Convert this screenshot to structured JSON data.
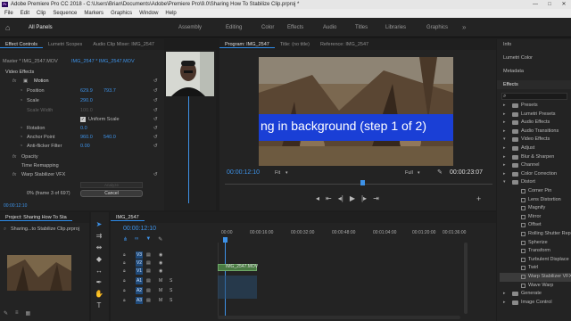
{
  "window": {
    "app_icon": "Pr",
    "title": "Adobe Premiere Pro CC 2018 - C:\\Users\\Brian\\Documents\\Adobe\\Premiere Pro\\9.0\\Sharing How To Stabilize Clip.prproj *",
    "controls": [
      "—",
      "□",
      "✕"
    ]
  },
  "menu": [
    "File",
    "Edit",
    "Clip",
    "Sequence",
    "Markers",
    "Graphics",
    "Window",
    "Help"
  ],
  "workspaces": [
    "All Panels",
    "Assembly",
    "Editing",
    "Color",
    "Effects",
    "Audio",
    "Titles",
    "Libraries",
    "Graphics"
  ],
  "effect_controls": {
    "tabs": [
      "Effect Controls",
      "Lumetri Scopes",
      "Audio Clip Mixer: IMG_2547"
    ],
    "source": "Master * IMG_2547.MOV",
    "clip": "IMG_2547 * IMG_2547.MOV",
    "section": "Video Effects",
    "motion": "Motion",
    "rows": [
      {
        "label": "Position",
        "v1": "629.9",
        "v2": "793.7"
      },
      {
        "label": "Scale",
        "v1": "290.0",
        "v2": ""
      },
      {
        "label": "Scale Width",
        "v1": "100.0",
        "v2": ""
      },
      {
        "label": "Uniform Scale",
        "v1": "",
        "v2": ""
      },
      {
        "label": "Rotation",
        "v1": "0.0",
        "v2": ""
      },
      {
        "label": "Anchor Point",
        "v1": "960.0",
        "v2": "540.0"
      },
      {
        "label": "Anti-flicker Filter",
        "v1": "0.00",
        "v2": ""
      }
    ],
    "opacity": "Opacity",
    "time_remapping": "Time Remapping",
    "warp": "Warp Stabilizer VFX",
    "analyze_label": "Analyze",
    "progress": "0% (frame 3 of 697)",
    "cancel": "Cancel",
    "timecode": "00:00:12:10"
  },
  "program": {
    "tabs": [
      "Program: IMG_2547",
      "Title: (no title)",
      "Reference: IMG_2547"
    ],
    "overlay_text": "ng in background (step 1 of 2)",
    "timecode": "00:00:12:10",
    "fit": "Fit",
    "quality": "Full",
    "duration": "00:00:23:07"
  },
  "right_tabs": [
    "Info",
    "Lumetri Color",
    "Metadata",
    "Effects"
  ],
  "effects_list": [
    {
      "type": "folder",
      "label": "Presets",
      "open": false
    },
    {
      "type": "folder",
      "label": "Lumetri Presets",
      "open": false
    },
    {
      "type": "folder",
      "label": "Audio Effects",
      "open": false
    },
    {
      "type": "folder",
      "label": "Audio Transitions",
      "open": false
    },
    {
      "type": "folder",
      "label": "Video Effects",
      "open": true
    },
    {
      "type": "folder",
      "label": "Adjust",
      "open": false
    },
    {
      "type": "folder",
      "label": "Blur & Sharpen",
      "open": false
    },
    {
      "type": "folder",
      "label": "Channel",
      "open": false
    },
    {
      "type": "folder",
      "label": "Color Correction",
      "open": false
    },
    {
      "type": "folder",
      "label": "Distort",
      "open": true
    },
    {
      "type": "effect",
      "label": "Corner Pin"
    },
    {
      "type": "effect",
      "label": "Lens Distortion"
    },
    {
      "type": "effect",
      "label": "Magnify"
    },
    {
      "type": "effect",
      "label": "Mirror"
    },
    {
      "type": "effect",
      "label": "Offset"
    },
    {
      "type": "effect",
      "label": "Rolling Shutter Repair"
    },
    {
      "type": "effect",
      "label": "Spherize"
    },
    {
      "type": "effect",
      "label": "Transform"
    },
    {
      "type": "effect",
      "label": "Turbulent Displace"
    },
    {
      "type": "effect",
      "label": "Twirl"
    },
    {
      "type": "effect",
      "label": "Warp Stabilizer VFX",
      "selected": true
    },
    {
      "type": "effect",
      "label": "Wave Warp"
    },
    {
      "type": "folder",
      "label": "Generate",
      "open": false
    },
    {
      "type": "folder",
      "label": "Image Control",
      "open": false
    }
  ],
  "project": {
    "tab": "Project: Sharing How To Sta",
    "file": "Sharing...to Stabilize Clip.prproj"
  },
  "timeline": {
    "tab": "IMG_2547",
    "timecode": "00:00:12:10",
    "ruler": [
      "00:00",
      "00:00:16:00",
      "00:00:32:00",
      "00:00:48:00",
      "00:01:04:00",
      "00:01:20:00",
      "00:01:36:00"
    ],
    "tracks": [
      "V3",
      "V2",
      "V1",
      "A1",
      "A2",
      "A3"
    ],
    "clip": "IMG_2547.MOV",
    "mute": "M",
    "solo": "S"
  }
}
